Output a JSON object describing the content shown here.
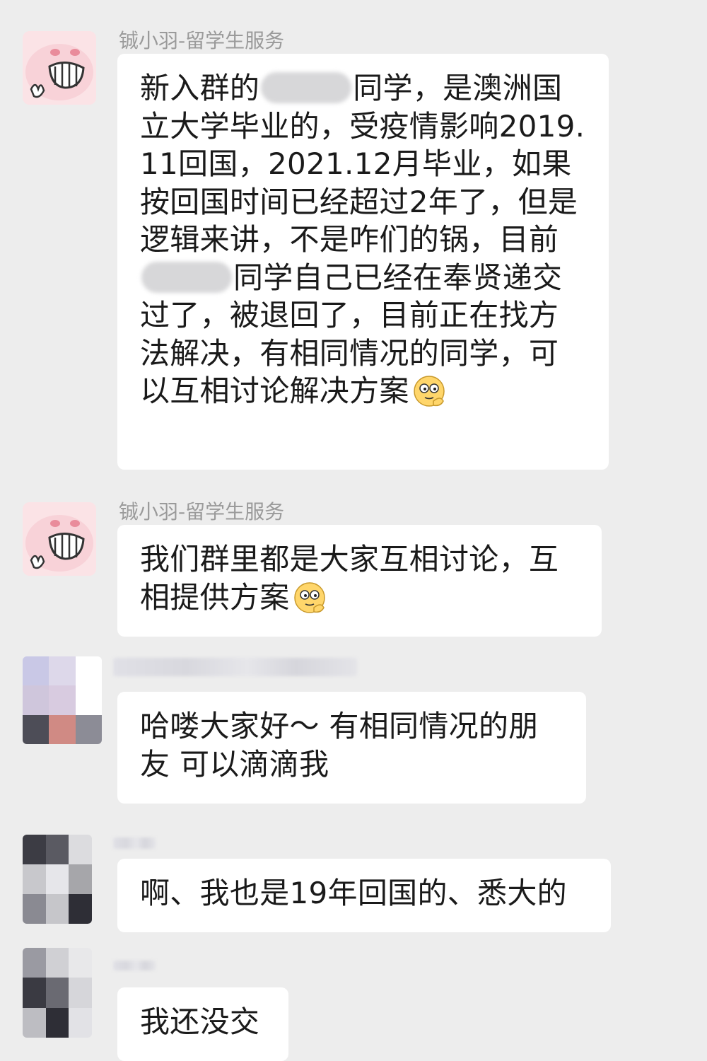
{
  "messages": [
    {
      "id": "m1",
      "sender": "铖小羽-留学生服务",
      "avatar": "pig",
      "segments": [
        {
          "t": "text",
          "v": "新入群的"
        },
        {
          "t": "blur"
        },
        {
          "t": "text",
          "v": "同学，是澳洲国立大学毕业的，受疫情影响2019.11回国，2021.12月毕业，如果按回国时间已经超过2年了，但是逻辑来讲，不是咋们的锅，目前"
        },
        {
          "t": "blur"
        },
        {
          "t": "text",
          "v": "同学自己已经在奉贤递交过了，被退回了，目前正在找方法解决，有相同情况的同学，可以互相讨论解决方案"
        },
        {
          "t": "emoji",
          "name": "smirk-emoji"
        }
      ]
    },
    {
      "id": "m2",
      "sender": "铖小羽-留学生服务",
      "avatar": "pig",
      "segments": [
        {
          "t": "text",
          "v": "我们群里都是大家互相讨论，互相提供方案"
        },
        {
          "t": "emoji",
          "name": "smirk-emoji"
        }
      ]
    },
    {
      "id": "m3",
      "sender": "",
      "avatar": "mosaic",
      "mosaic_colors": [
        "#c9c8e6",
        "#ddd8ea",
        "#ffffff",
        "#cfc6dc",
        "#d8cbe0",
        "#ffffff",
        "#4d4d57",
        "#d08a84",
        "#8c8c96"
      ],
      "segments": [
        {
          "t": "text",
          "v": "哈喽大家好～  有相同情况的朋友  可以滴滴我"
        }
      ]
    },
    {
      "id": "m4",
      "sender": "",
      "avatar": "mosaic",
      "mosaic_colors": [
        "#3c3c44",
        "#5a5a62",
        "#dcdcdf",
        "#c8c8cc",
        "#e6e6ea",
        "#a6a6aa",
        "#8a8a92",
        "#c6c6ca",
        "#2e2e36"
      ],
      "segments": [
        {
          "t": "text",
          "v": "啊、我也是19年回国的、悉大的"
        }
      ]
    },
    {
      "id": "m5",
      "sender": "",
      "avatar": "mosaic",
      "mosaic_colors": [
        "#9a9aa2",
        "#d0d0d4",
        "#e8e8ea",
        "#3a3a42",
        "#6a6a72",
        "#d6d6da",
        "#bdbdc2",
        "#2e2e36",
        "#e2e2e6"
      ],
      "segments": [
        {
          "t": "text",
          "v": "我还没交"
        }
      ]
    }
  ]
}
